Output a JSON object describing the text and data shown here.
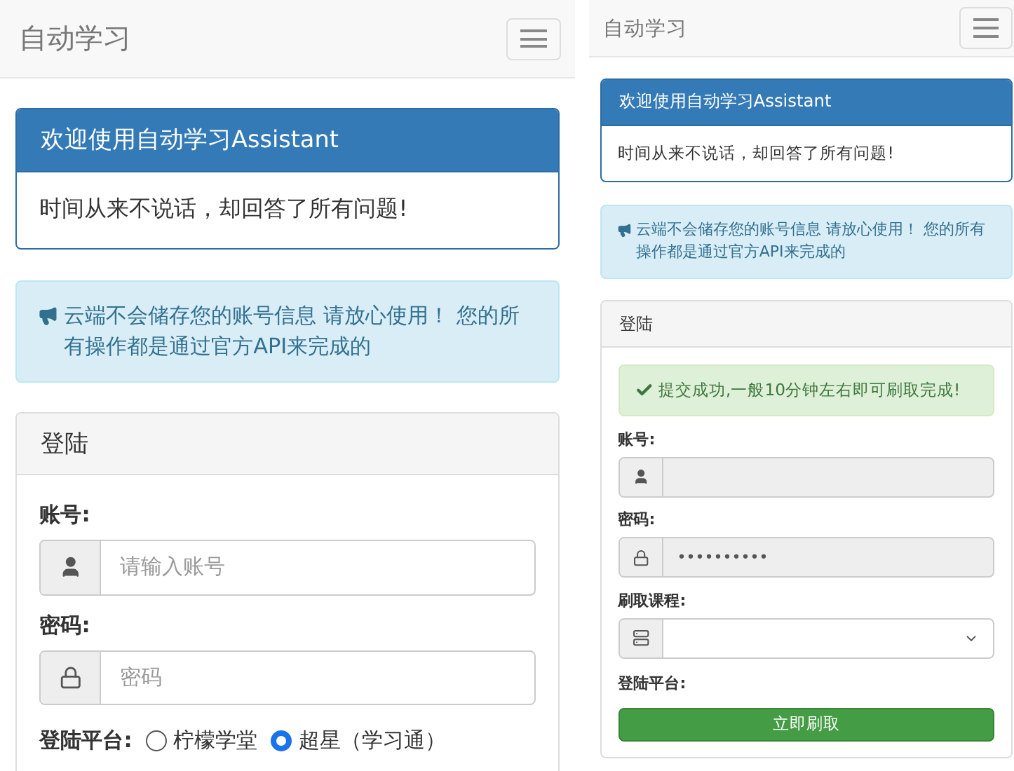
{
  "screens": [
    {
      "kind": "wide",
      "navbar": {
        "title": "自动学习"
      },
      "welcome_panel": {
        "heading": "欢迎使用自动学习Assistant",
        "body": "时间从来不说话，却回答了所有问题!"
      },
      "notice": {
        "text": "云端不会储存您的账号信息 请放心使用！ 您的所有操作都是通过官方API来完成的"
      },
      "login_panel": {
        "heading": "登陆",
        "fields": [
          {
            "kind": "text",
            "label": "账号:",
            "placeholder": "请输入账号",
            "disabled": false
          },
          {
            "kind": "password",
            "label": "密码:",
            "placeholder": "密码",
            "disabled": false
          }
        ],
        "platform": {
          "label": "登陆平台:",
          "options": [
            {
              "label": "柠檬学堂",
              "selected": false
            },
            {
              "label": "超星（学习通）",
              "selected": true
            }
          ]
        }
      }
    },
    {
      "kind": "narrow",
      "navbar": {
        "title": "自动学习"
      },
      "welcome_panel": {
        "heading": "欢迎使用自动学习Assistant",
        "body": "时间从来不说话，却回答了所有问题!"
      },
      "notice": {
        "text": "云端不会储存您的账号信息 请放心使用！ 您的所有操作都是通过官方API来完成的"
      },
      "login_panel": {
        "heading": "登陆",
        "success_alert": "提交成功,一般10分钟左右即可刷取完成!",
        "fields": [
          {
            "kind": "text",
            "label": "账号:",
            "disabled": true
          },
          {
            "kind": "password",
            "label": "密码:",
            "value": "••••••••••",
            "disabled": true
          },
          {
            "kind": "select",
            "label": "刷取课程:",
            "disabled": false
          }
        ],
        "platform": {
          "label": "登陆平台:"
        },
        "submit_button": "立即刷取"
      }
    }
  ]
}
